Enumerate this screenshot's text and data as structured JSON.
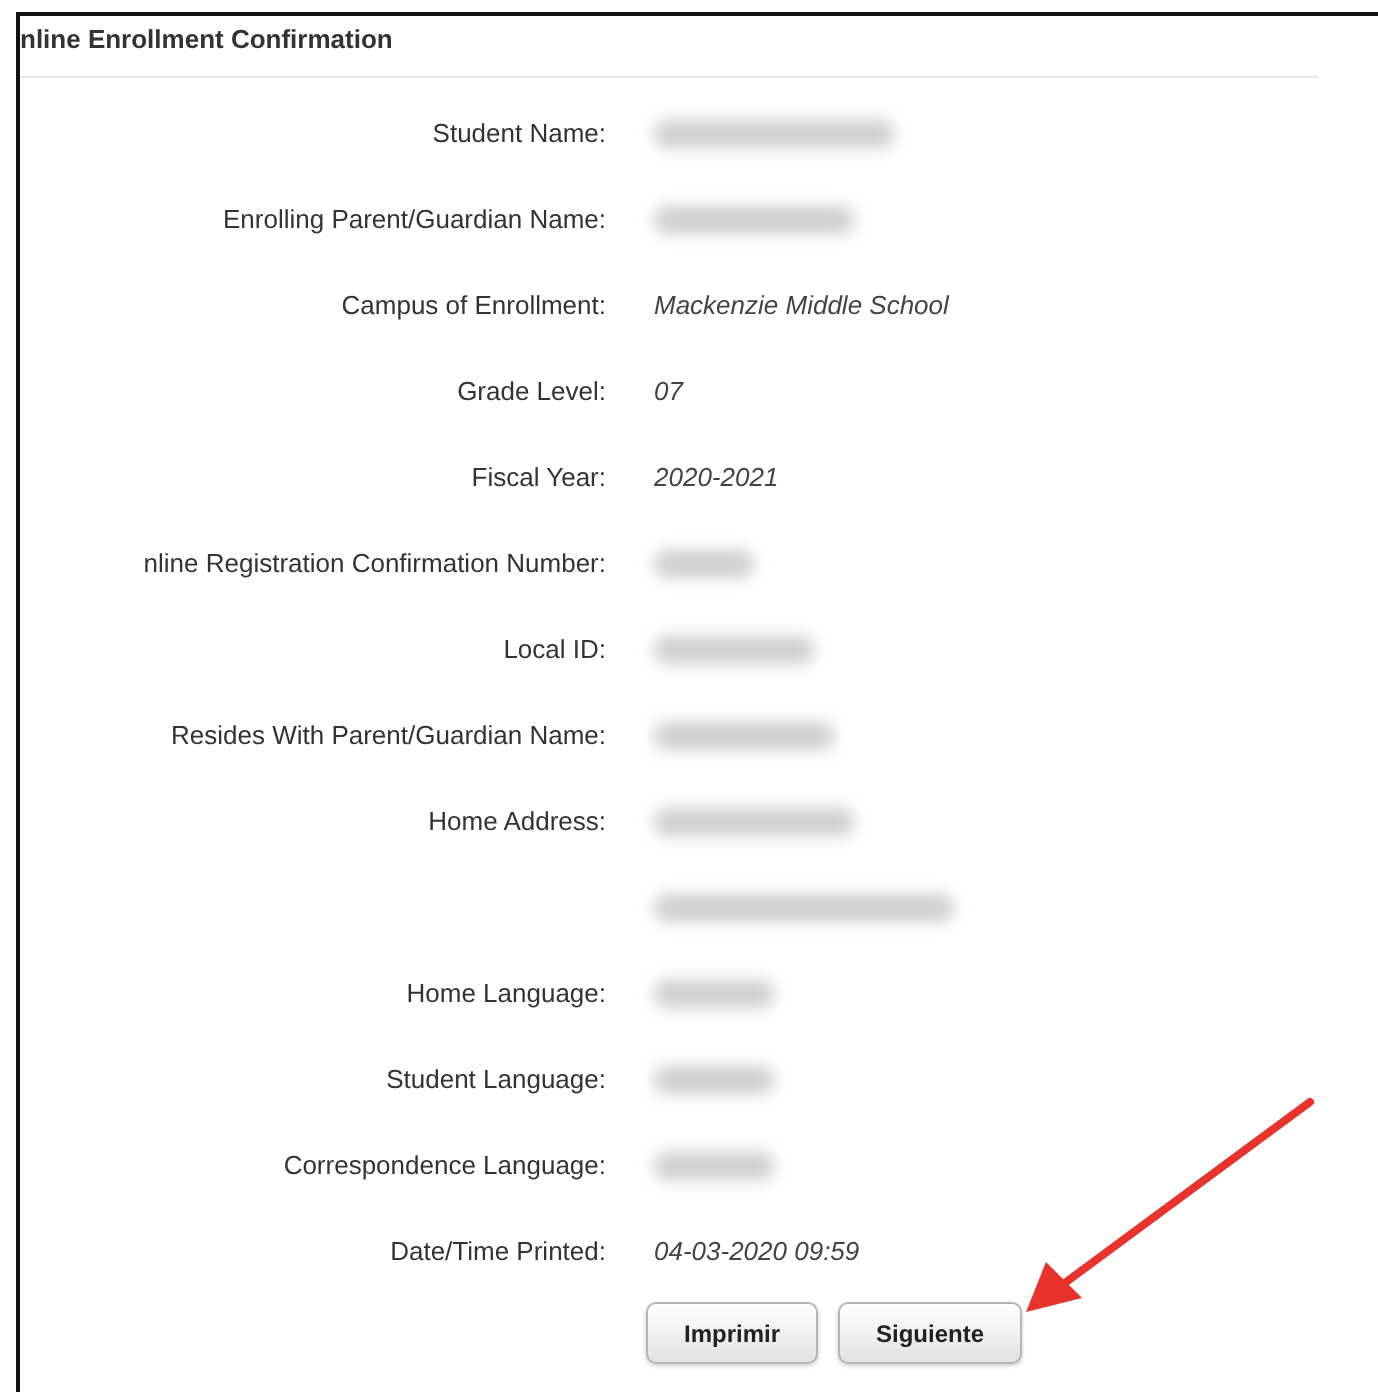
{
  "title": "nline Enrollment Confirmation",
  "rows": [
    {
      "label": "Student Name:",
      "kind": "redacted"
    },
    {
      "label": "Enrolling Parent/Guardian Name:",
      "kind": "redacted"
    },
    {
      "label": "Campus of Enrollment:",
      "kind": "text",
      "value": "Mackenzie Middle School"
    },
    {
      "label": "Grade Level:",
      "kind": "text",
      "value": "07"
    },
    {
      "label": "Fiscal Year:",
      "kind": "text",
      "value": "2020-2021"
    },
    {
      "label": "nline Registration Confirmation Number:",
      "kind": "redacted"
    },
    {
      "label": "Local ID:",
      "kind": "redacted"
    },
    {
      "label": "Resides With Parent/Guardian Name:",
      "kind": "redacted"
    },
    {
      "label": "Home Address:",
      "kind": "redacted"
    },
    {
      "kind": "redacted"
    },
    {
      "label": "Home Language:",
      "kind": "redacted"
    },
    {
      "label": "Student Language:",
      "kind": "redacted"
    },
    {
      "label": "Correspondence Language:",
      "kind": "redacted"
    },
    {
      "label": "Date/Time Printed:",
      "kind": "text",
      "value": "04-03-2020 09:59"
    }
  ],
  "buttons": [
    {
      "label": "Imprimir"
    },
    {
      "label": "Siguiente"
    }
  ]
}
